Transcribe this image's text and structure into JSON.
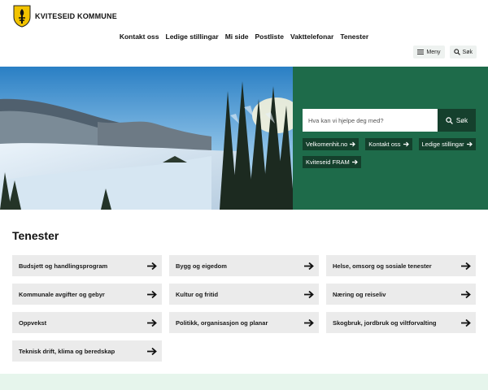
{
  "site": {
    "name": "KVITESEID KOMMUNE"
  },
  "nav": {
    "links": [
      "Kontakt oss",
      "Ledige stillingar",
      "Mi side",
      "Postliste",
      "Vakttelefonar",
      "Tenester"
    ]
  },
  "utility": {
    "menu_label": "Meny",
    "search_label": "Søk"
  },
  "hero": {
    "search_placeholder": "Hva kan vi hjelpe deg med?",
    "search_button": "Søk",
    "quick_links": [
      "Velkomenhit.no",
      "Kontakt oss",
      "Ledige stillingar",
      "Kviteseid FRAM"
    ]
  },
  "services": {
    "title": "Tenester",
    "items": [
      "Budsjett og handlingsprogram",
      "Bygg og eigedom",
      "Helse, omsorg og sosiale tenester",
      "Kommunale avgifter og gebyr",
      "Kultur og fritid",
      "Næring og reiseliv",
      "Oppvekst",
      "Politikk, organisasjon og planar",
      "Skogbruk, jordbruk og viltforvalting",
      "Teknisk drift, klima og beredskap"
    ]
  },
  "colors": {
    "brand_green": "#1e6b4a",
    "dark_green": "#15402d",
    "card_bg": "#ebebeb",
    "footer_mint": "#e6f5ec"
  },
  "icons": {
    "logo": "municipal-shield-icon",
    "menu": "hamburger-icon",
    "search": "magnifier-icon",
    "arrow": "arrow-right-icon"
  }
}
